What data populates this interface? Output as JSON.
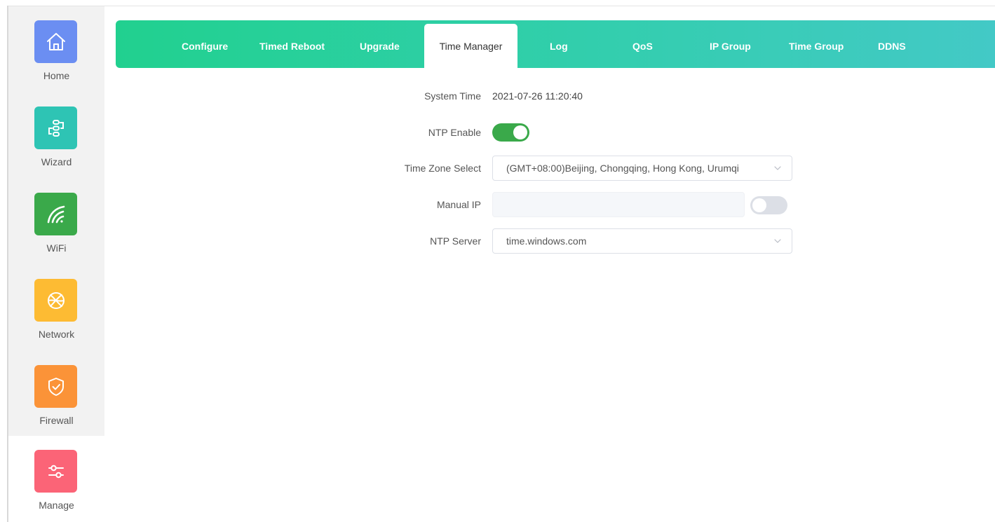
{
  "sidebar": {
    "items": [
      {
        "label": "Home",
        "icon": "home-icon",
        "color": "#6b8ef2"
      },
      {
        "label": "Wizard",
        "icon": "wizard-icon",
        "color": "#2ec4b4"
      },
      {
        "label": "WiFi",
        "icon": "wifi-icon",
        "color": "#3aa94a"
      },
      {
        "label": "Network",
        "icon": "network-icon",
        "color": "#fdbb33"
      },
      {
        "label": "Firewall",
        "icon": "firewall-shield-icon",
        "color": "#fb9338"
      },
      {
        "label": "Manage",
        "icon": "manage-sliders-icon",
        "color": "#fb6477"
      }
    ],
    "active": "Manage"
  },
  "tabs": {
    "items": [
      "Configure",
      "Timed Reboot",
      "Upgrade",
      "Time Manager",
      "Log",
      "QoS",
      "IP Group",
      "Time Group",
      "DDNS"
    ],
    "active": "Time Manager"
  },
  "form": {
    "system_time_label": "System Time",
    "system_time_value": "2021-07-26 11:20:40",
    "ntp_enable_label": "NTP Enable",
    "ntp_enable_on": true,
    "time_zone_label": "Time Zone Select",
    "time_zone_value": "(GMT+08:00)Beijing, Chongqing, Hong Kong, Urumqi",
    "manual_ip_label": "Manual IP",
    "manual_ip_value": "",
    "manual_ip_on": false,
    "ntp_server_label": "NTP Server",
    "ntp_server_value": "time.windows.com"
  },
  "colors": {
    "tabbar_start": "#21d08f",
    "tabbar_end": "#43c9c6",
    "toggle_on": "#3aa94a",
    "toggle_off": "#dcdfe6"
  }
}
